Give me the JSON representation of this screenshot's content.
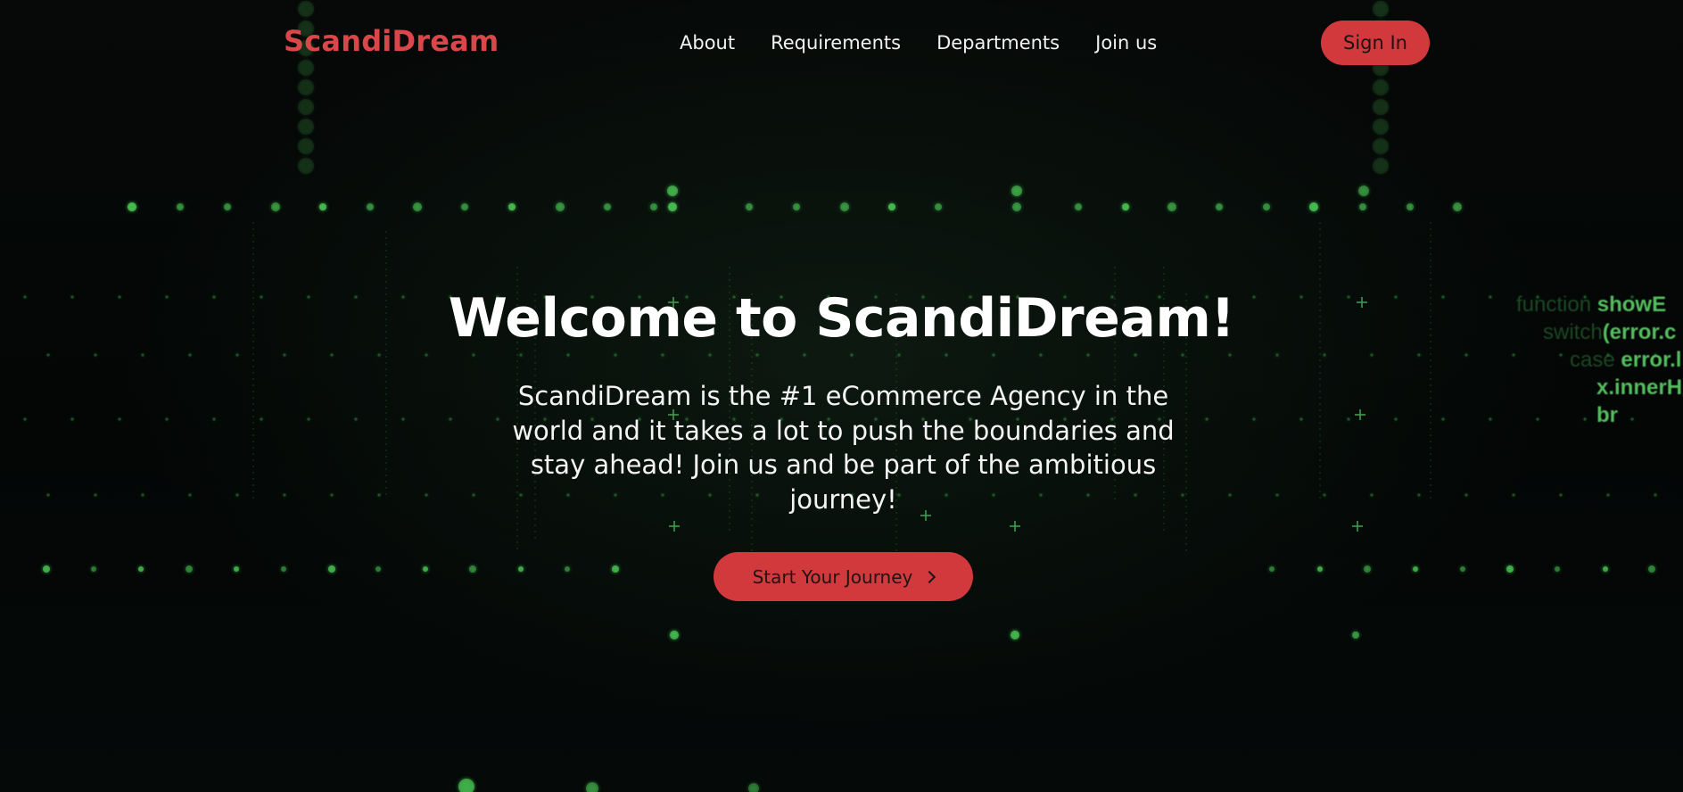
{
  "brand": {
    "name": "ScandiDream",
    "color": "#d9474a"
  },
  "nav": {
    "links": [
      "About",
      "Requirements",
      "Departments",
      "Join us"
    ],
    "signin_label": "Sign In"
  },
  "hero": {
    "title": "Welcome to ScandiDream!",
    "description": "ScandiDream is the #1 eCommerce Agency in the world and it takes a lot to push the boundaries and stay ahead! Join us and be part of the ambitious journey!",
    "cta_label": "Start Your Journey",
    "cta_icon": "chevron-right-icon"
  },
  "background": {
    "code_lines": [
      {
        "dim": "function ",
        "bright": "showE"
      },
      {
        "dim": "switch",
        "bright": "(error.c"
      },
      {
        "dim": "case ",
        "bright": "error.l"
      },
      {
        "dim": "",
        "bright": "x.innerH"
      },
      {
        "dim": "",
        "bright": "br"
      }
    ]
  },
  "colors": {
    "accent": "#d2393d",
    "matrix_green": "#46be50",
    "background": "#050807"
  }
}
